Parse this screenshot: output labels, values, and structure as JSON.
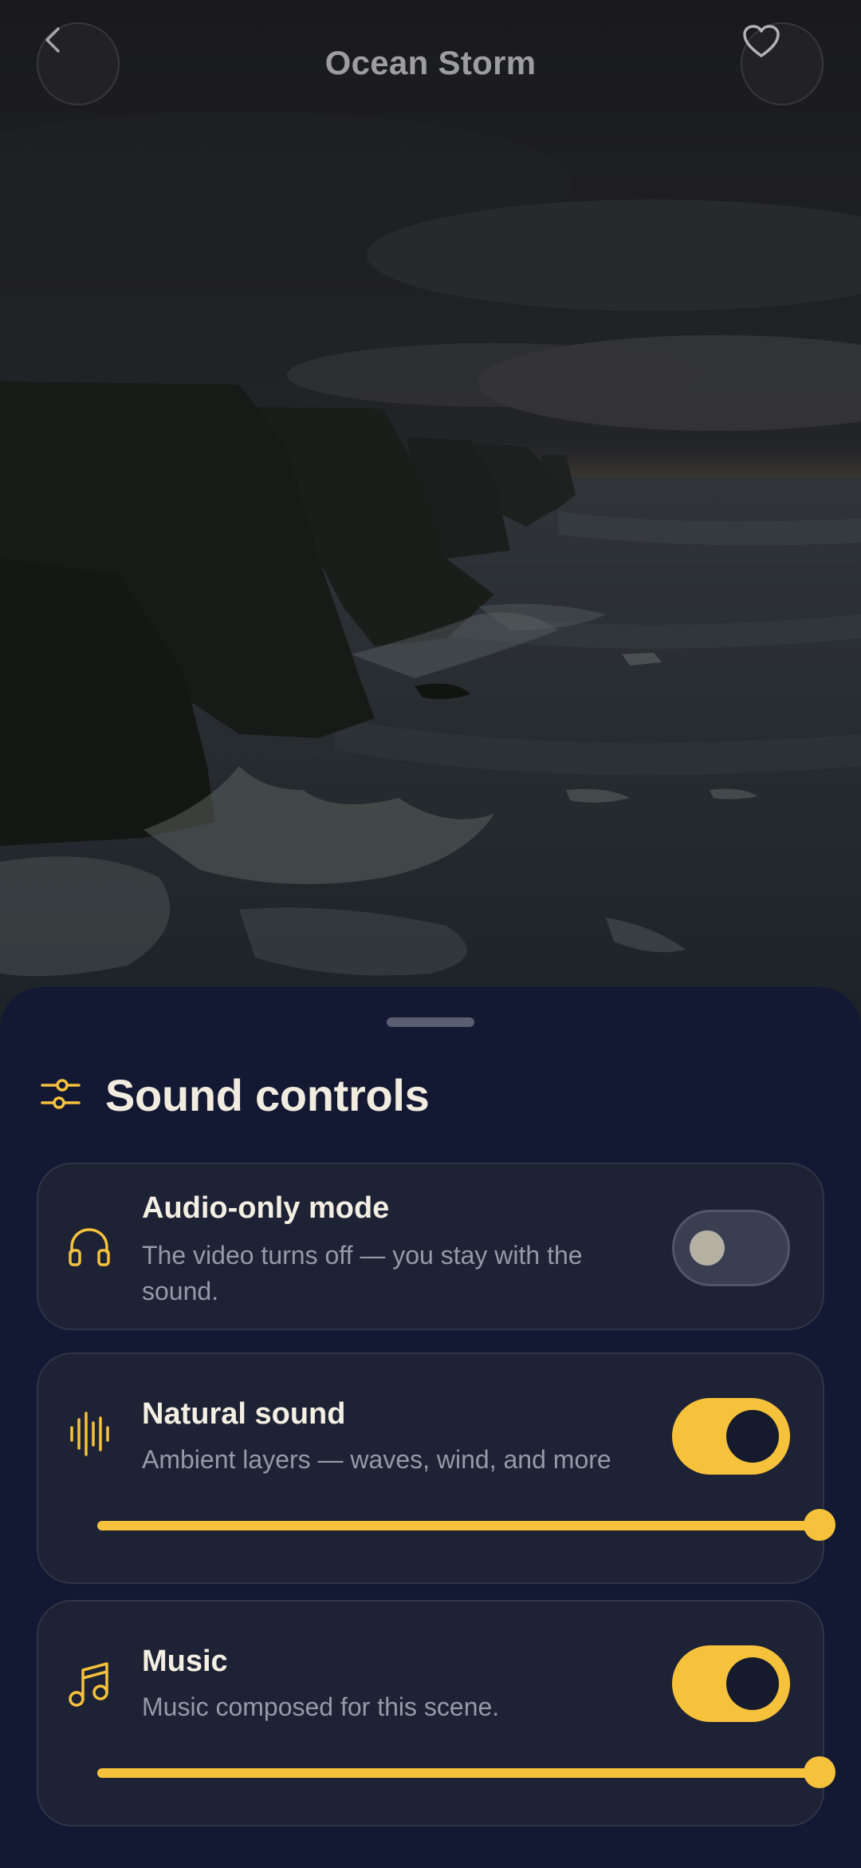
{
  "header": {
    "title": "Ocean Storm",
    "back_icon": "chevron-left-icon",
    "favorite_icon": "heart-outline-icon"
  },
  "sheet": {
    "title": "Sound controls",
    "title_icon": "sliders-icon"
  },
  "cards": [
    {
      "title": "Audio-only mode",
      "description": "The video turns off — you stay with the sound.",
      "icon": "headphones-icon",
      "toggle_on": false
    },
    {
      "title": "Natural sound",
      "description": "Ambient layers — waves, wind, and more",
      "icon": "waveform-icon",
      "toggle_on": true,
      "volume": 1.0
    },
    {
      "title": "Music",
      "description": "Music composed for this scene.",
      "icon": "music-note-icon",
      "toggle_on": true,
      "volume": 1.0
    }
  ],
  "colors": {
    "accent": "#f6c23b",
    "sheet_background": "#141933",
    "card_background": "#1e2235"
  }
}
